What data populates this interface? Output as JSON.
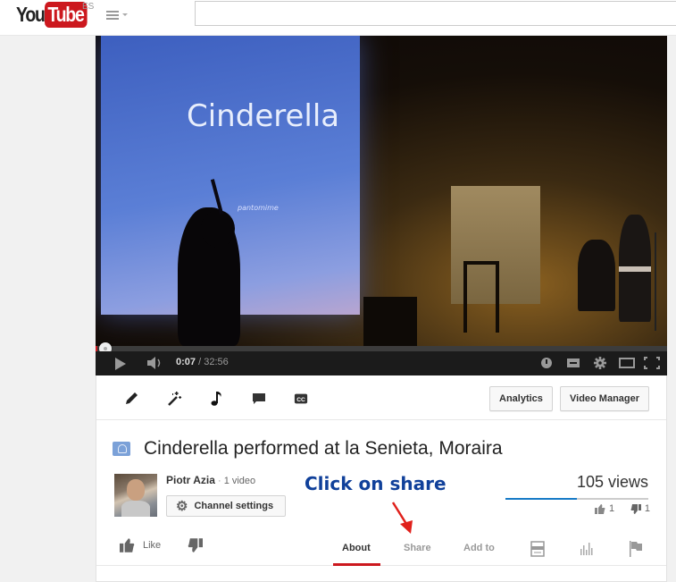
{
  "header": {
    "logo_you": "You",
    "logo_tube": "Tube",
    "country": "ES",
    "search": {
      "value": "",
      "placeholder": ""
    }
  },
  "player": {
    "slide_title": "Cinderella",
    "slide_subtitle": "pantomime",
    "current_time": "0:07",
    "time_separator": " / ",
    "duration": "32:56",
    "progress_fraction": 0.0035,
    "icons": [
      "play-icon",
      "volume-icon",
      "watch-later-icon",
      "captions-icon",
      "settings-icon",
      "theater-mode-icon",
      "fullscreen-icon"
    ]
  },
  "edit_toolbar": {
    "icons": [
      "edit-pencil-icon",
      "enhancements-wand-icon",
      "audio-note-icon",
      "annotations-icon",
      "captions-cc-icon"
    ],
    "cc_label": "CC",
    "analytics_label": "Analytics",
    "video_manager_label": "Video Manager"
  },
  "video": {
    "title": "Cinderella performed at la Senieta, Moraira",
    "owner_name": "Piotr Azia",
    "owner_sep": " · ",
    "owner_video_count": "1 video",
    "channel_settings_label": "Channel settings",
    "views": "105 views",
    "like_count": "1",
    "dislike_count": "1",
    "like_ratio": 0.5
  },
  "annotation": {
    "text": "Click on share",
    "color": "#10409a",
    "arrow_color": "#e0201b"
  },
  "actions": {
    "like_label": "Like",
    "tabs": [
      {
        "label": "About",
        "active": true
      },
      {
        "label": "Share",
        "active": false
      },
      {
        "label": "Add to",
        "active": false
      }
    ],
    "icon_tabs": [
      "transcript-icon",
      "statistics-icon",
      "report-flag-icon"
    ]
  },
  "colors": {
    "brand_red": "#cc181e",
    "accent_blue": "#167ac6"
  }
}
